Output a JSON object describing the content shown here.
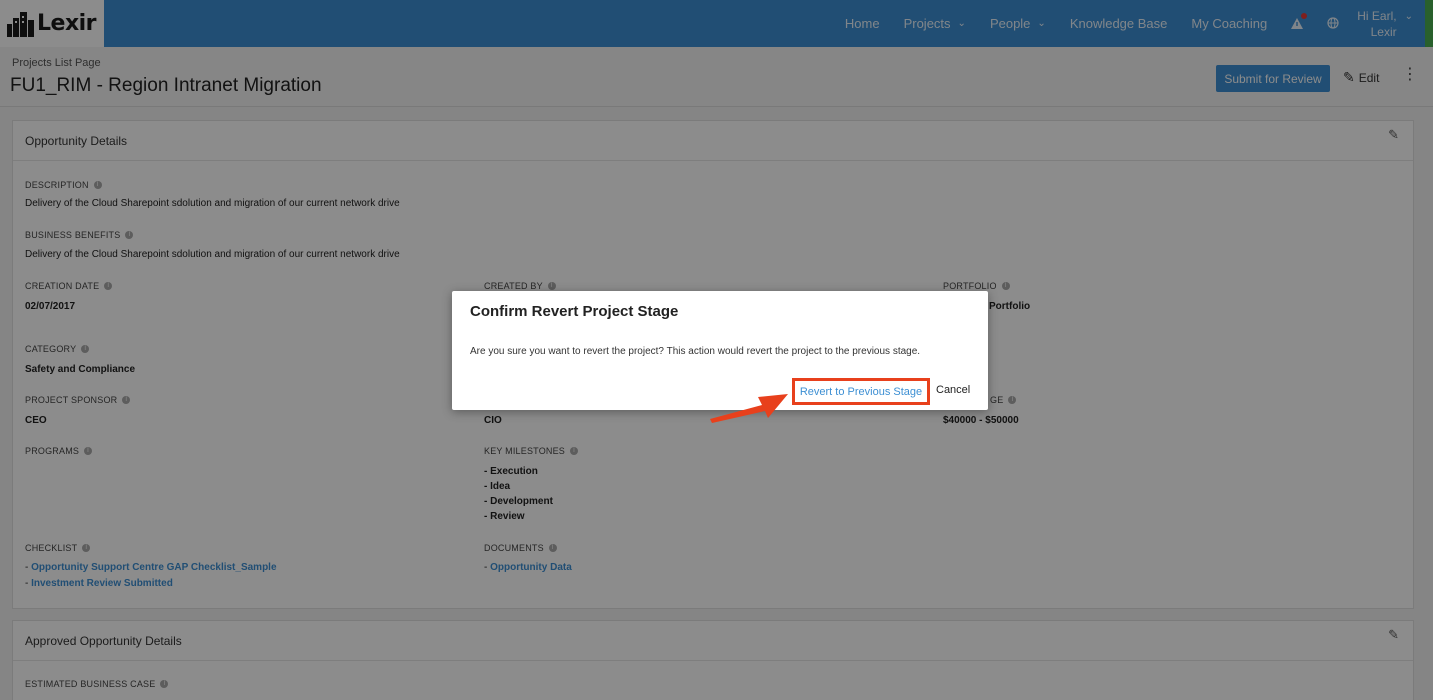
{
  "brand": {
    "name": "Lexir",
    "logo_icon": "building-logo-icon"
  },
  "nav": {
    "items": [
      {
        "label": "Home",
        "dropdown": false
      },
      {
        "label": "Projects",
        "dropdown": true
      },
      {
        "label": "People",
        "dropdown": true
      },
      {
        "label": "Knowledge Base",
        "dropdown": false
      },
      {
        "label": "My Coaching",
        "dropdown": false
      }
    ],
    "user": {
      "greeting": "Hi Earl,",
      "org": "Lexir"
    }
  },
  "header": {
    "breadcrumb": "Projects List Page",
    "title": "FU1_RIM - Region Intranet Migration",
    "submit_label": "Submit for Review",
    "edit_label": "Edit"
  },
  "opportunity": {
    "heading": "Opportunity Details",
    "description_label": "DESCRIPTION",
    "description_value": "Delivery of the Cloud Sharepoint sdolution and migration of our current network drive",
    "benefits_label": "BUSINESS BENEFITS",
    "benefits_value": "Delivery of the Cloud Sharepoint sdolution and migration of our current network drive",
    "creation_date_label": "CREATION DATE",
    "creation_date_value": "02/07/2017",
    "created_by_label": "CREATED BY",
    "portfolio_label": "PORTFOLIO",
    "portfolio_value_partial": "Portfolio",
    "category_label": "CATEGORY",
    "category_value": "Safety and Compliance",
    "sponsor_label": "PROJECT SPONSOR",
    "sponsor_value": "CEO",
    "manager_value": "CIO",
    "budget_label_partial": "GE",
    "budget_value": "$40000 - $50000",
    "programs_label": "PROGRAMS",
    "milestones_label": "KEY MILESTONES",
    "milestones": [
      "- Execution",
      "- Idea",
      "- Development",
      "- Review"
    ],
    "checklist_label": "CHECKLIST",
    "checklist_links": [
      "Opportunity Support Centre GAP Checklist_Sample",
      "Investment Review Submitted"
    ],
    "documents_label": "DOCUMENTS",
    "documents_links": [
      "Opportunity Data"
    ]
  },
  "approved": {
    "heading": "Approved Opportunity Details",
    "business_case_label": "ESTIMATED BUSINESS CASE"
  },
  "modal": {
    "title": "Confirm Revert Project Stage",
    "message": "Are you sure you want to revert the project? This action would revert the project to the previous stage.",
    "confirm_label": "Revert to Previous Stage",
    "cancel_label": "Cancel"
  },
  "colors": {
    "brand_blue": "#3d8fd3",
    "highlight_red": "#e8401c",
    "accent_green": "#4caf50"
  }
}
